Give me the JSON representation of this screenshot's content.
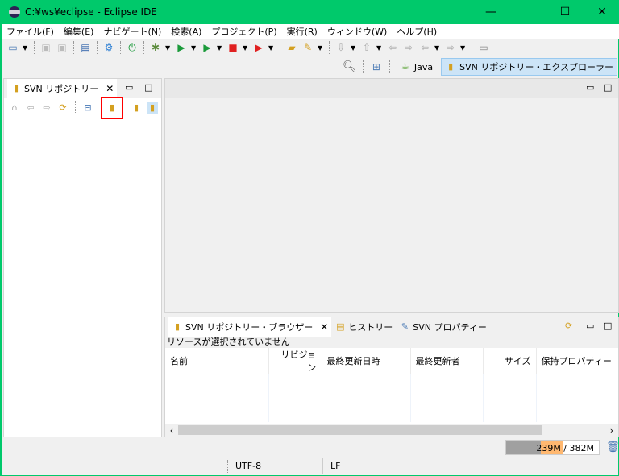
{
  "window": {
    "title": "C:¥ws¥eclipse - Eclipse IDE",
    "minimize": "—",
    "maximize": "☐",
    "close": "✕"
  },
  "menu": [
    "ファイル(F)",
    "編集(E)",
    "ナビゲート(N)",
    "検索(A)",
    "プロジェクト(P)",
    "実行(R)",
    "ウィンドウ(W)",
    "ヘルプ(H)"
  ],
  "perspectives": {
    "java": "Java",
    "svn": "SVN リポジトリー・エクスプローラー"
  },
  "left_view": {
    "tab": "SVN リポジトリー"
  },
  "bottom_view": {
    "tabs": [
      "SVN リポジトリー・ブラウザー",
      "ヒストリー",
      "SVN プロパティー"
    ],
    "message": "リソースが選択されていません",
    "columns": [
      "名前",
      "リビジョン",
      "最終更新日時",
      "最終更新者",
      "サイズ",
      "保持プロパティー"
    ]
  },
  "status": {
    "heap": "239M / 382M",
    "heap_used_fraction": 0.63,
    "encoding": "UTF-8",
    "line_ending": "LF"
  },
  "highlight_color": "#ff0000"
}
